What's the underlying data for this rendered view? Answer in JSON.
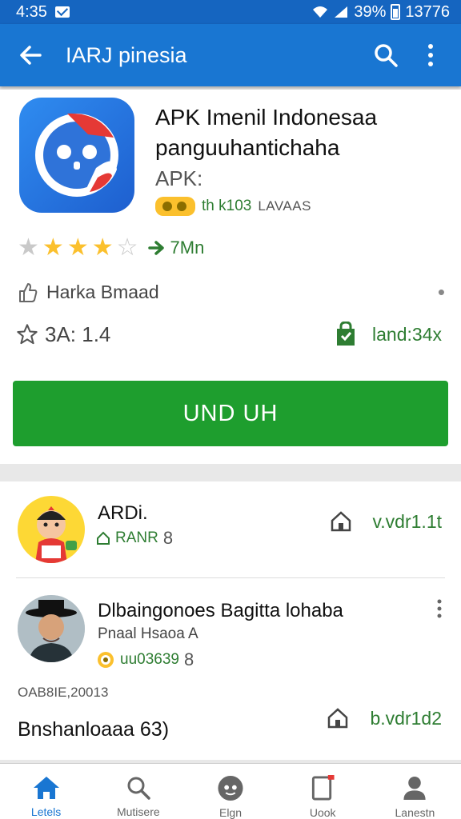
{
  "status_bar": {
    "time": "4:35",
    "battery_text": "39%",
    "clock_right": "13776"
  },
  "app_bar": {
    "title": "IARJ pinesia"
  },
  "app": {
    "name": "APK Imenil Indonesaa panguuhantichaha",
    "subtitle": "APK:",
    "badge_label": "th k103",
    "badge_extra": "LAVAAS",
    "rating_stars": 4,
    "rating_max": 5,
    "trend_text": "7Mn",
    "likes_label": "Harka Bmaad",
    "rating_text": "3A: 1.4",
    "size_text": "land:34x",
    "install_label": "UND UH"
  },
  "list": [
    {
      "title": "ARDi.",
      "tag": "RANR",
      "tag_count": "8",
      "right_text": "v.vdr1.1t"
    },
    {
      "title": "Dlbaingonoes Bagitta lohaba",
      "subtitle": "Pnaal Hsaoa A",
      "tag": "uu03639",
      "tag_count": "8",
      "date": "OAB8IE,20013",
      "bottom_text": "Bnshanloaaa 63)",
      "right_text": "b.vdr1d2"
    }
  ],
  "bottom_nav": [
    {
      "label": "Letels",
      "icon": "home-icon",
      "active": true
    },
    {
      "label": "Mutisere",
      "icon": "search-icon",
      "active": false
    },
    {
      "label": "Elgn",
      "icon": "games-icon",
      "active": false
    },
    {
      "label": "Uook",
      "icon": "tablet-icon",
      "active": false
    },
    {
      "label": "Lanestn",
      "icon": "account-icon",
      "active": false
    }
  ],
  "colors": {
    "app_bar": "#1976d2",
    "status_bar": "#1565c0",
    "install_button": "#1e9e2e",
    "accent_green": "#2e7d32",
    "star": "#fbc02d"
  }
}
